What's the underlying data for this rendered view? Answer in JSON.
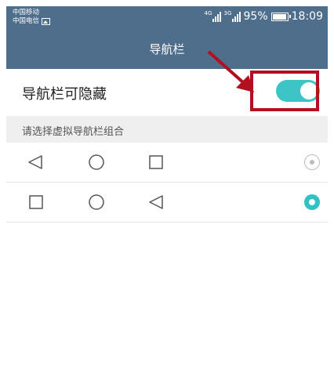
{
  "status_bar": {
    "carrier_1": "中国移动",
    "carrier_2": "中国电信",
    "net_1": "4G",
    "net_2": "3G",
    "battery": "95%",
    "time": "18:09"
  },
  "header": {
    "title": "导航栏"
  },
  "toggle": {
    "label": "导航栏可隐藏",
    "on": true
  },
  "section": {
    "label": "请选择虚拟导航栏组合"
  },
  "options": [
    {
      "buttons": [
        "back-icon",
        "home-icon",
        "recent-icon"
      ],
      "selected": false
    },
    {
      "buttons": [
        "recent-icon",
        "home-icon",
        "back-icon"
      ],
      "selected": true
    }
  ],
  "colors": {
    "header_bg": "#4e6e8c",
    "accent": "#3cc4c6",
    "annotation": "#b3101f"
  }
}
